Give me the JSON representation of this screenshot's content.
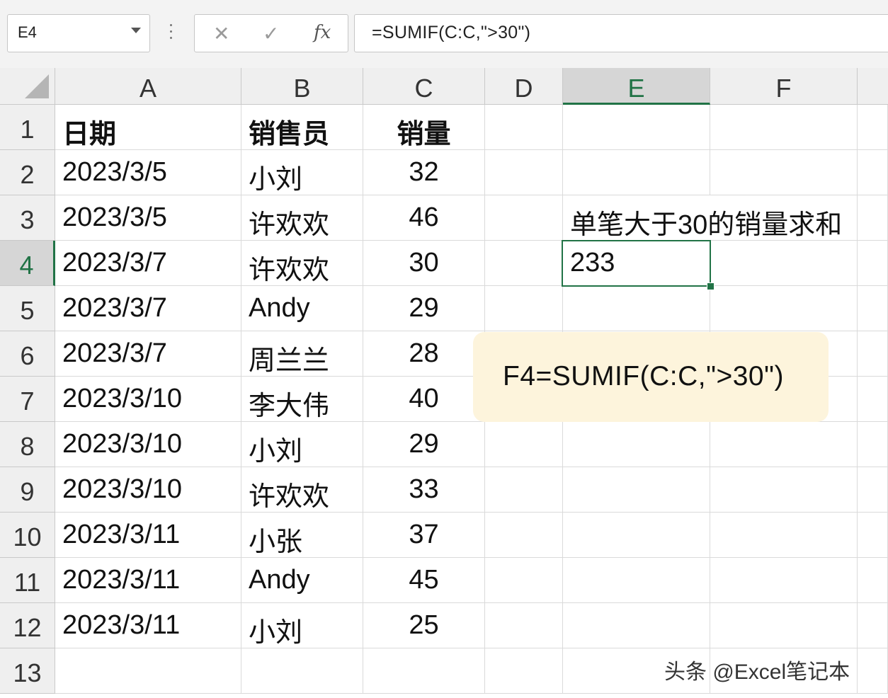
{
  "formula_bar": {
    "name_box": "E4",
    "cancel_icon": "✕",
    "enter_icon": "✓",
    "fx_label": "fx",
    "formula": "=SUMIF(C:C,\">30\")"
  },
  "columns": [
    "A",
    "B",
    "C",
    "D",
    "E",
    "F"
  ],
  "selected_column": "E",
  "rows": [
    "1",
    "2",
    "3",
    "4",
    "5",
    "6",
    "7",
    "8",
    "9",
    "10",
    "11",
    "12",
    "13"
  ],
  "selected_row": "4",
  "table": {
    "headers": [
      "日期",
      "销售员",
      "销量"
    ],
    "data": [
      [
        "2023/3/5",
        "小刘",
        "32"
      ],
      [
        "2023/3/5",
        "许欢欢",
        "46"
      ],
      [
        "2023/3/7",
        "许欢欢",
        "30"
      ],
      [
        "2023/3/7",
        "Andy",
        "29"
      ],
      [
        "2023/3/7",
        "周兰兰",
        "28"
      ],
      [
        "2023/3/10",
        "李大伟",
        "40"
      ],
      [
        "2023/3/10",
        "小刘",
        "29"
      ],
      [
        "2023/3/10",
        "许欢欢",
        "33"
      ],
      [
        "2023/3/11",
        "小张",
        "37"
      ],
      [
        "2023/3/11",
        "Andy",
        "45"
      ],
      [
        "2023/3/11",
        "小刘",
        "25"
      ]
    ]
  },
  "side": {
    "label": "单笔大于30的销量求和",
    "result": "233"
  },
  "note": "F4=SUMIF(C:C,\">30\")",
  "watermark": "头条 @Excel笔记本",
  "colors": {
    "accent": "#217346",
    "note_bg": "#fdf4dc"
  }
}
